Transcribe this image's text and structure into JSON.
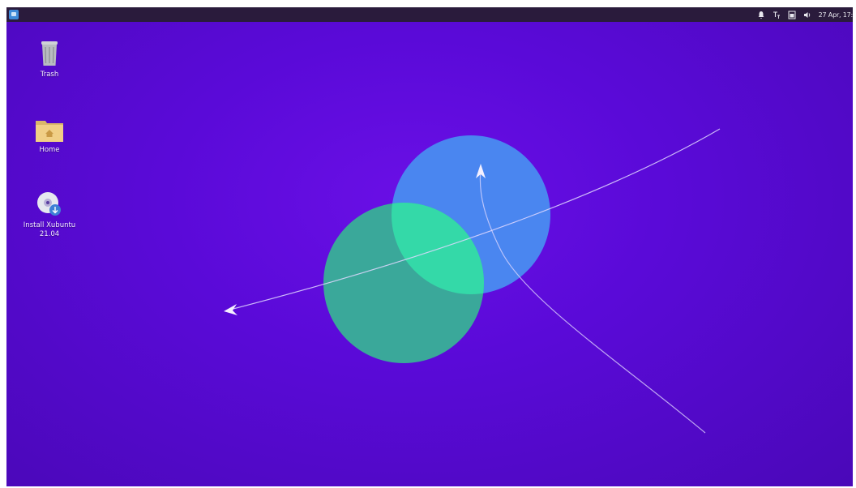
{
  "panel": {
    "menu_icon": "whisker-menu-icon",
    "tray_icons": [
      "notification-bell-icon",
      "keyboard-layout-icon",
      "battery-icon",
      "volume-icon"
    ],
    "clock": "27 Apr, 17:"
  },
  "desktop": {
    "icons": [
      {
        "label": "Trash",
        "icon": "trash-icon"
      },
      {
        "label": "Home",
        "icon": "home-folder-icon"
      },
      {
        "label": "Install Xubuntu\n21.04",
        "icon": "install-disc-icon"
      }
    ]
  },
  "wallpaper": {
    "colors": {
      "background": "#5a0ad8",
      "blue_circle": "#4a86f0",
      "green_circle": "#3aa89a",
      "overlap": "#34d9a8",
      "lines": "#d8d0ff"
    }
  }
}
